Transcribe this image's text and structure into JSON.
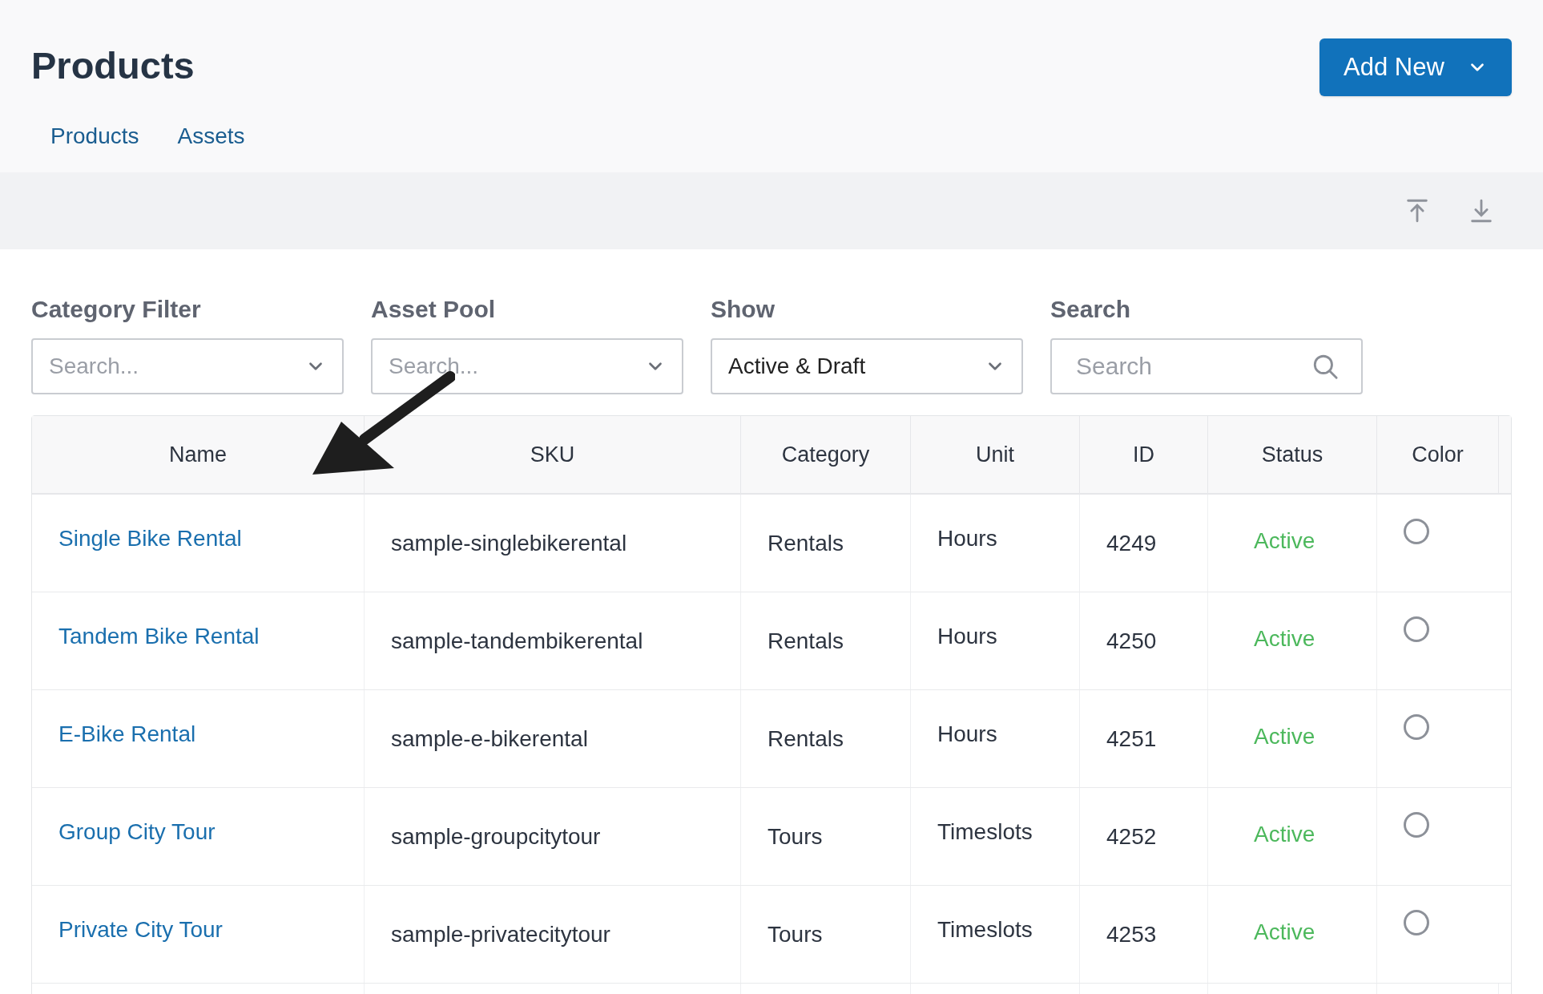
{
  "header": {
    "title": "Products",
    "add_button": "Add New"
  },
  "tabs": [
    {
      "label": "Products",
      "selected": false
    },
    {
      "label": "Assets",
      "selected": false
    }
  ],
  "filters": [
    {
      "kind": "select",
      "label": "Category Filter",
      "placeholder": "Search..."
    },
    {
      "kind": "select",
      "label": "Asset Pool",
      "placeholder": "Search..."
    },
    {
      "kind": "select",
      "label": "Show",
      "value": "Active & Draft"
    },
    {
      "kind": "search",
      "label": "Search",
      "placeholder": "Search"
    }
  ],
  "table": {
    "columns": [
      "Name",
      "SKU",
      "Category",
      "Unit",
      "ID",
      "Status",
      "Color"
    ],
    "rows": [
      {
        "name": "Single Bike Rental",
        "sku": "sample-singlebikerental",
        "category": "Rentals",
        "unit": "Hours",
        "id": "4249",
        "status": "Active"
      },
      {
        "name": "Tandem Bike Rental",
        "sku": "sample-tandembikerental",
        "category": "Rentals",
        "unit": "Hours",
        "id": "4250",
        "status": "Active"
      },
      {
        "name": "E-Bike Rental",
        "sku": "sample-e-bikerental",
        "category": "Rentals",
        "unit": "Hours",
        "id": "4251",
        "status": "Active"
      },
      {
        "name": "Group City Tour",
        "sku": "sample-groupcitytour",
        "category": "Tours",
        "unit": "Timeslots",
        "id": "4252",
        "status": "Active"
      },
      {
        "name": "Private City Tour",
        "sku": "sample-privatecitytour",
        "category": "Tours",
        "unit": "Timeslots",
        "id": "4253",
        "status": "Active"
      }
    ]
  }
}
